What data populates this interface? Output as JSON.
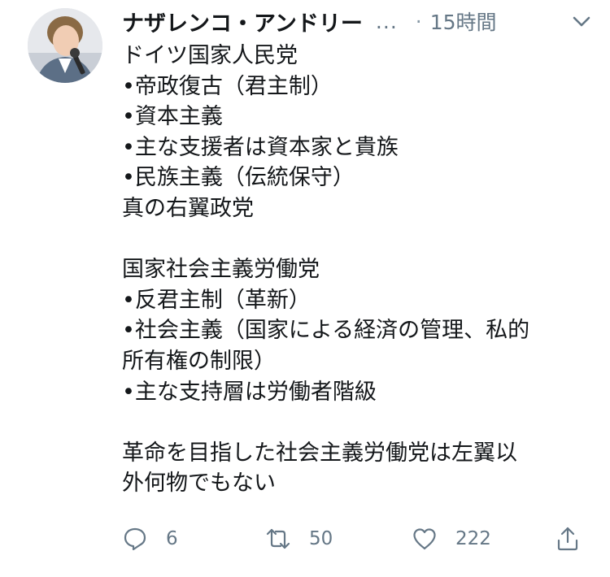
{
  "tweet": {
    "display_name": "ナザレンコ・アンドリー",
    "name_overflow": "...",
    "separator": "·",
    "timestamp": "15時間",
    "lines": [
      "ドイツ国家人民党",
      "•帝政復古（君主制）",
      "•資本主義",
      "•主な支援者は資本家と貴族",
      "•民族主義（伝統保守）",
      "真の右翼政党",
      "",
      "国家社会主義労働党",
      "•反君主制（革新）",
      "•社会主義（国家による経済の管理、私的",
      "所有権の制限）",
      "•主な支持層は労働者階級",
      "",
      "革命を目指した社会主義労働党は左翼以",
      "外何物でもない"
    ]
  },
  "actions": {
    "reply_count": "6",
    "retweet_count": "50",
    "like_count": "222"
  },
  "icons": {
    "menu": "chevron-down-icon",
    "reply": "reply-icon",
    "retweet": "retweet-icon",
    "like": "heart-icon",
    "share": "share-icon"
  },
  "colors": {
    "text": "#14171a",
    "secondary": "#657786"
  }
}
